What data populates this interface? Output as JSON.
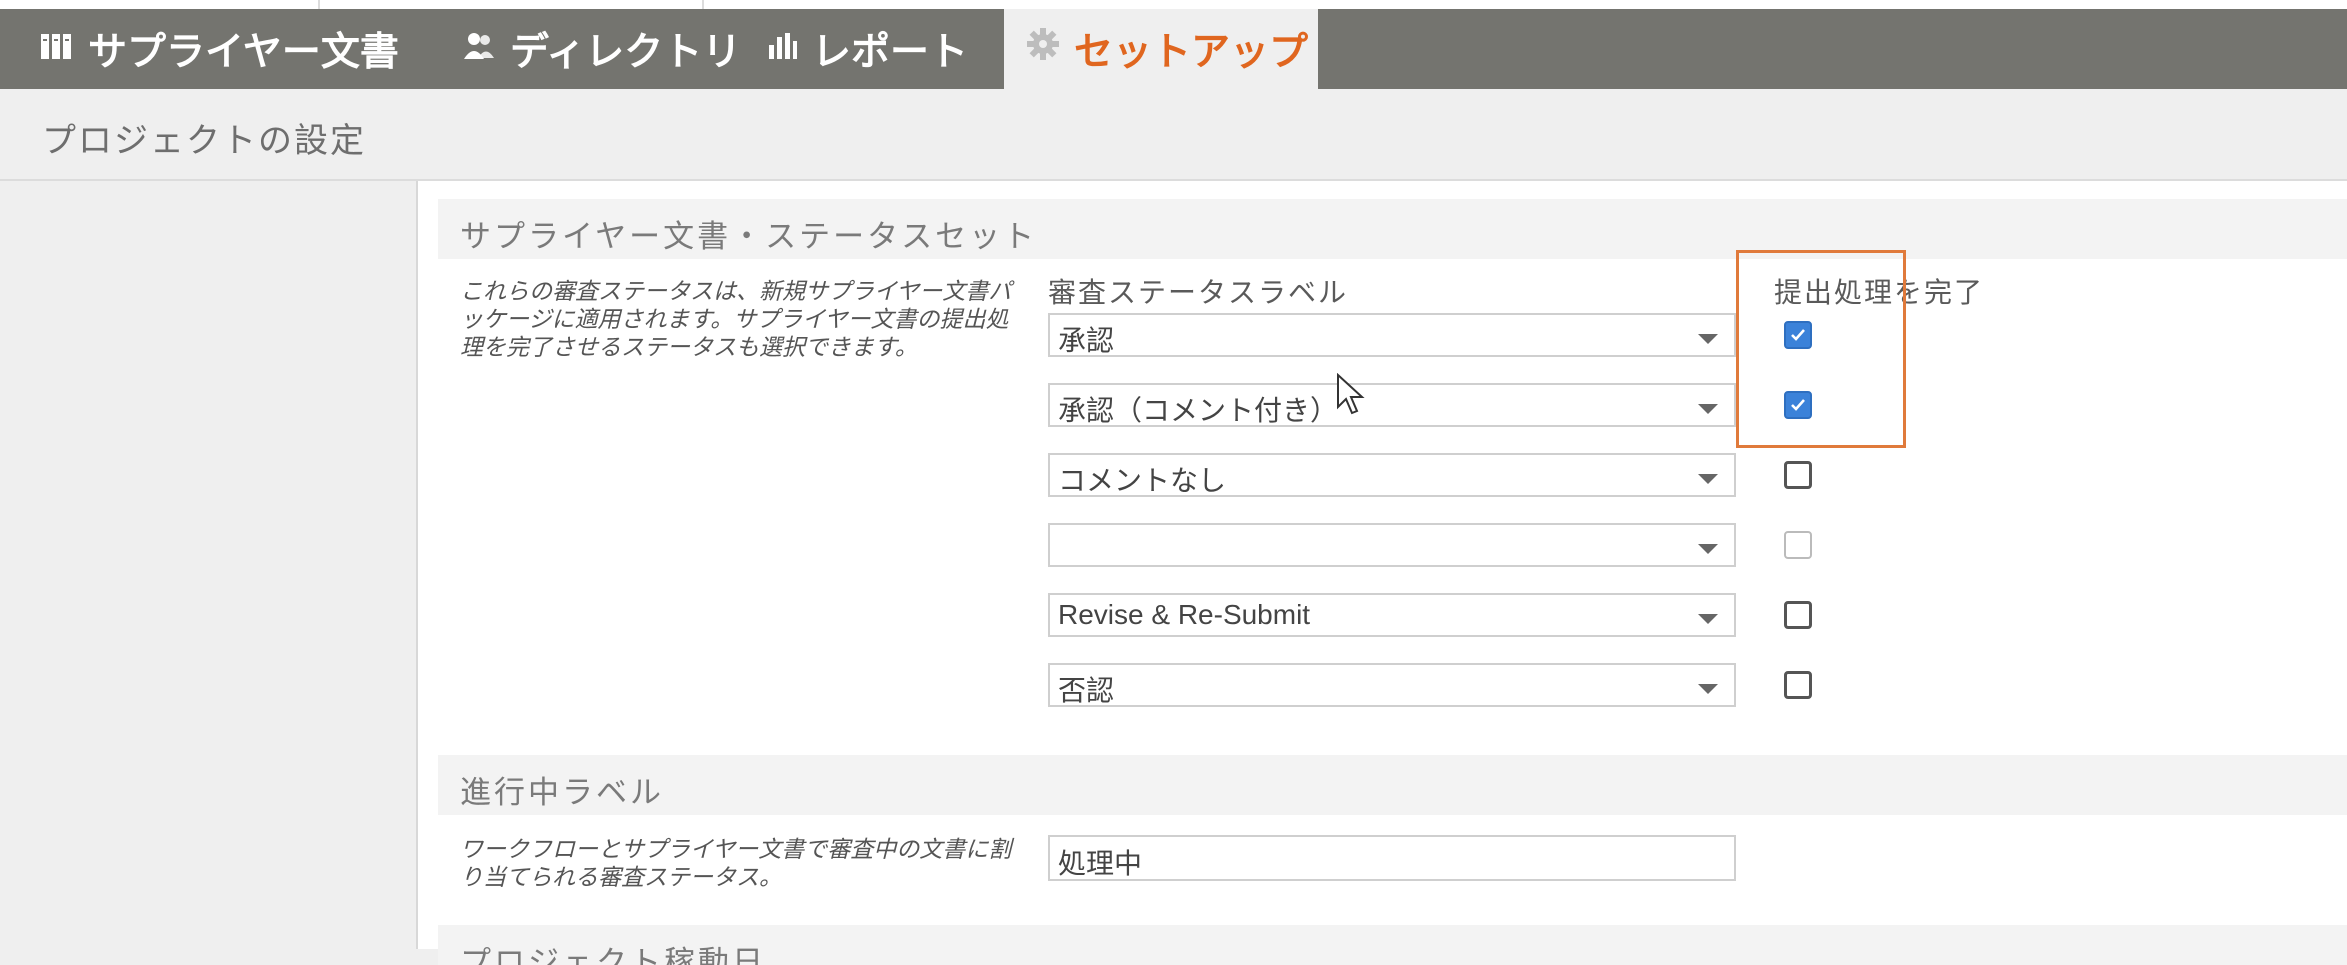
{
  "nav": {
    "tabs": [
      {
        "label": "サプライヤー文書",
        "icon": "binders-icon"
      },
      {
        "label": "ディレクトリ",
        "icon": "people-icon"
      },
      {
        "label": "レポート",
        "icon": "bar-chart-icon"
      },
      {
        "label": "セットアップ",
        "icon": "gear-icon",
        "active": true
      }
    ],
    "active_color": "#e0661f",
    "bar_color": "#74746f"
  },
  "page": {
    "title": "プロジェクトの設定"
  },
  "status_section": {
    "header": "サプライヤー文書・ステータスセット",
    "description": "これらの審査ステータスは、新規サプライヤー文書パッケージに適用されます。サプライヤー文書の提出処理を完了させるステータスも選択できます。",
    "label_column": "審査ステータスラベル",
    "complete_column": "提出処理を完了",
    "rows": [
      {
        "value": "承認",
        "complete": "checked"
      },
      {
        "value": "承認（コメント付き）",
        "complete": "checked"
      },
      {
        "value": "コメントなし",
        "complete": "unchecked"
      },
      {
        "value": "",
        "complete": "disabled"
      },
      {
        "value": "Revise & Re-Submit",
        "complete": "unchecked"
      },
      {
        "value": "否認",
        "complete": "unchecked"
      }
    ]
  },
  "progress_section": {
    "header": "進行中ラベル",
    "description": "ワークフローとサプライヤー文書で審査中の文書に割り当てられる審査ステータス。",
    "value": "処理中"
  },
  "next_section": {
    "header": "プロジェクト稼動日"
  }
}
